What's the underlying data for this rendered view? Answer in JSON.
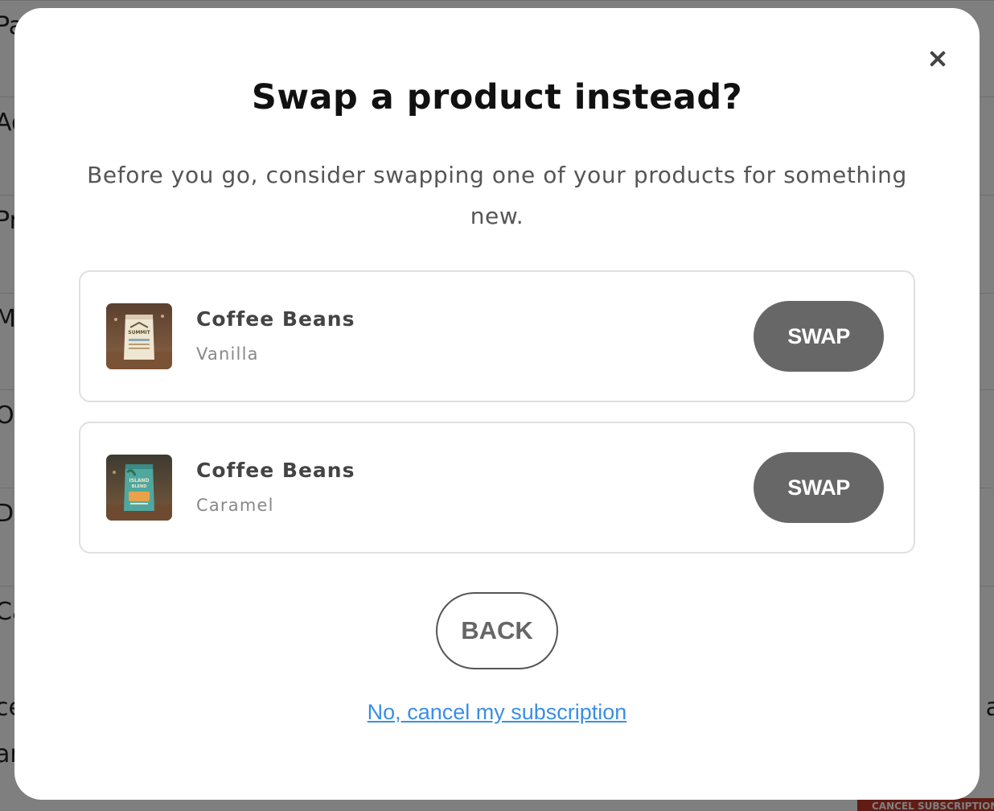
{
  "background": {
    "rows": [
      {
        "left": "Pa",
        "right": ""
      },
      {
        "left": "Ad",
        "right": ""
      },
      {
        "left": "Pr",
        "right": ""
      },
      {
        "left": "Ma",
        "right": ""
      },
      {
        "left": "Or",
        "right": ""
      },
      {
        "left": "Di",
        "right": ""
      },
      {
        "left": "Ca",
        "right": ""
      },
      {
        "left": "ce",
        "right": "a"
      },
      {
        "left": "ar",
        "right": ""
      }
    ],
    "cancel_button_label": "CANCEL SUBSCRIPTION"
  },
  "modal": {
    "close_icon": "close-icon",
    "title": "Swap a product instead?",
    "subtitle": "Before you go, consider swapping one of your products for something new.",
    "products": [
      {
        "name": "Coffee Beans",
        "variant": "Vanilla",
        "swap_label": "SWAP",
        "thumb_brand": "SUMMIT"
      },
      {
        "name": "Coffee Beans",
        "variant": "Caramel",
        "swap_label": "SWAP",
        "thumb_brand": "ISLAND BLEND"
      }
    ],
    "back_label": "BACK",
    "cancel_link": "No, cancel my subscription"
  },
  "colors": {
    "swap_button": "#676767",
    "link": "#3a8ee6",
    "overlay": "rgba(0,0,0,0.5)"
  }
}
